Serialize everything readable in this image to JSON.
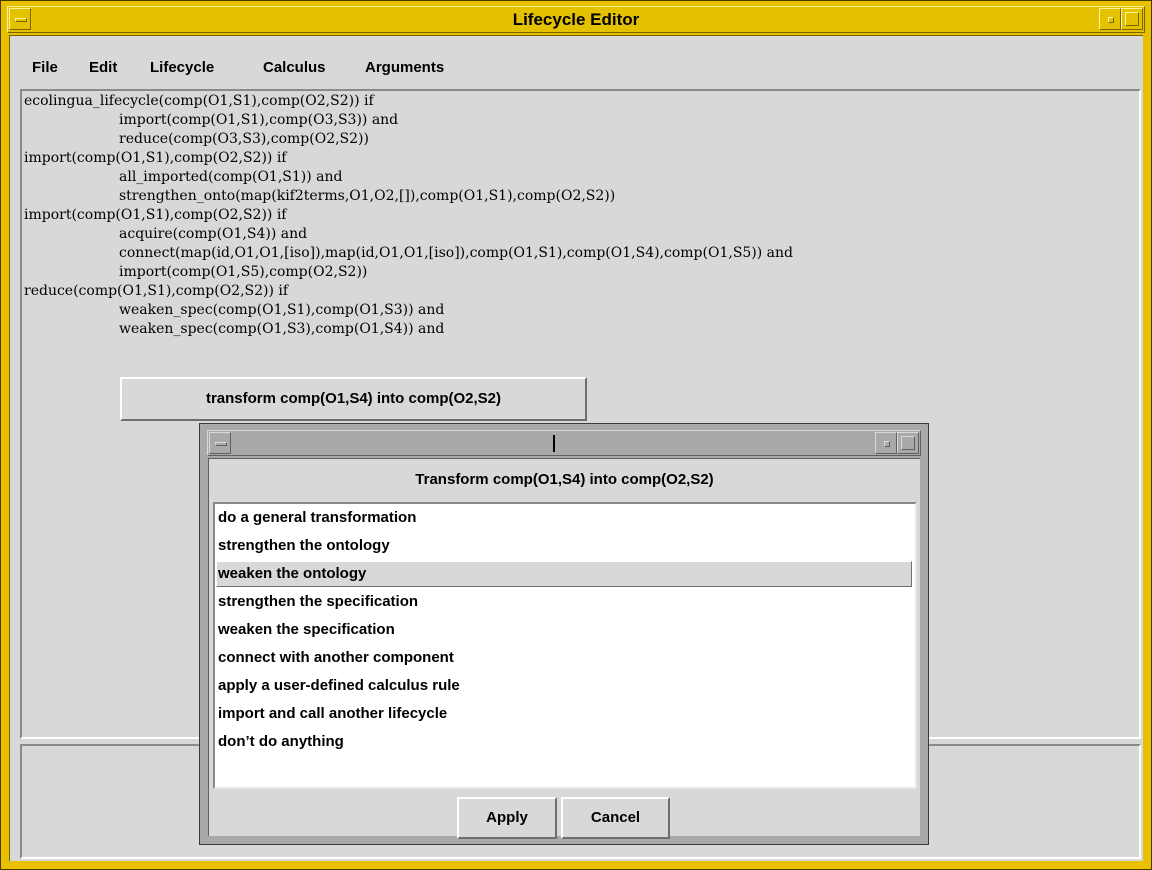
{
  "window": {
    "title": "Lifecycle Editor"
  },
  "menubar": {
    "items": [
      "File",
      "Edit",
      "Lifecycle",
      "Calculus",
      "Arguments"
    ]
  },
  "code_lines": [
    "ecolingua_lifecycle(comp(O1,S1),comp(O2,S2)) if",
    "import(comp(O1,S1),comp(O3,S3)) and",
    "reduce(comp(O3,S3),comp(O2,S2))",
    "import(comp(O1,S1),comp(O2,S2)) if",
    "all_imported(comp(O1,S1)) and",
    "strengthen_onto(map(kif2terms,O1,O2,[]),comp(O1,S1),comp(O2,S2))",
    "import(comp(O1,S1),comp(O2,S2)) if",
    "acquire(comp(O1,S4)) and",
    "connect(map(id,O1,O1,[iso]),map(id,O1,O1,[iso]),comp(O1,S1),comp(O1,S4),comp(O1,S5)) and",
    "import(comp(O1,S5),comp(O2,S2))",
    "reduce(comp(O1,S1),comp(O2,S2)) if",
    "weaken_spec(comp(O1,S1),comp(O1,S3)) and",
    "weaken_spec(comp(O1,S3),comp(O1,S4)) and"
  ],
  "popup_button": {
    "label": "transform comp(O1,S4) into comp(O2,S2)"
  },
  "dialog": {
    "heading": "Transform comp(O1,S4) into comp(O2,S2)",
    "options": [
      "do a general transformation",
      "strengthen the ontology",
      "weaken the ontology",
      "strengthen the specification",
      "weaken the specification",
      "connect with another component",
      "apply a user-defined calculus rule",
      "import and call another lifecycle",
      "don’t do anything"
    ],
    "selected_option": "weaken the ontology",
    "apply_label": "Apply",
    "cancel_label": "Cancel"
  },
  "colors": {
    "main_frame": "#e8c000",
    "dialog_frame": "#a9a9a9",
    "background": "#d8d8d8"
  }
}
